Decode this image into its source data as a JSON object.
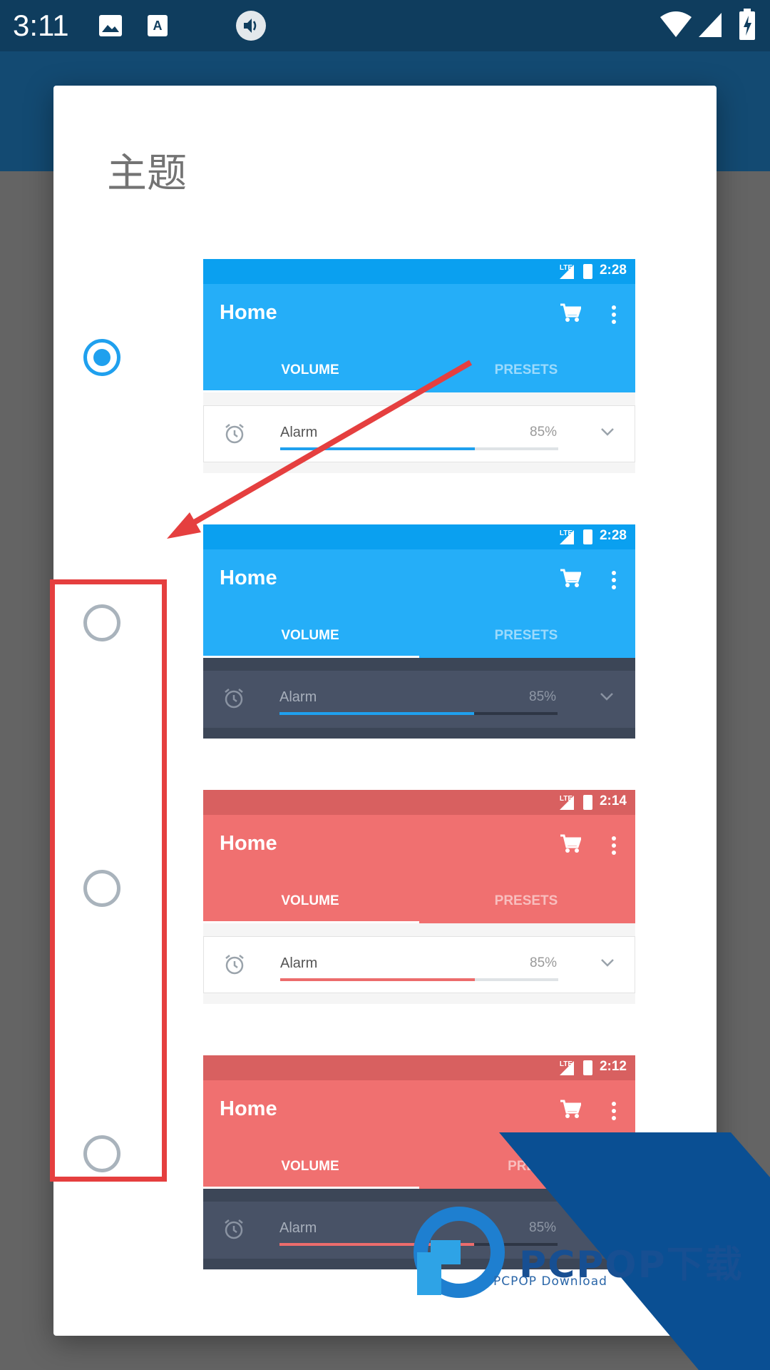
{
  "status_bar": {
    "time": "3:11"
  },
  "dialog": {
    "title": "主题"
  },
  "theme_options": [
    {
      "selected": true
    },
    {
      "selected": false
    },
    {
      "selected": false
    },
    {
      "selected": false
    }
  ],
  "previews": [
    {
      "clock": "2:28",
      "lte": "LTE",
      "title": "Home",
      "tab_volume": "VOLUME",
      "tab_presets": "PRESETS",
      "alarm_label": "Alarm",
      "alarm_percent": "85%",
      "alarm_level": 0.7
    },
    {
      "clock": "2:28",
      "lte": "LTE",
      "title": "Home",
      "tab_volume": "VOLUME",
      "tab_presets": "PRESETS",
      "alarm_label": "Alarm",
      "alarm_percent": "85%",
      "alarm_level": 0.7
    },
    {
      "clock": "2:14",
      "lte": "LTE",
      "title": "Home",
      "tab_volume": "VOLUME",
      "tab_presets": "PRESETS",
      "alarm_label": "Alarm",
      "alarm_percent": "85%",
      "alarm_level": 0.7
    },
    {
      "clock": "2:12",
      "lte": "LTE",
      "title": "Home",
      "tab_volume": "VOLUME",
      "tab_presets": "PRES",
      "alarm_label": "Alarm",
      "alarm_percent": "85%",
      "alarm_level": 0.7
    }
  ],
  "colors": {
    "accent_blue": "#1fa0ee",
    "accent_red": "#f07070",
    "annotation": "#e53f3f"
  },
  "watermark": {
    "brand": "PCPOP下载",
    "subtitle": "PCPOP Download"
  },
  "icons": [
    "image-icon",
    "a-icon",
    "volume-icon",
    "wifi-icon",
    "signal-icon",
    "battery-icon",
    "cart-icon",
    "more-vert-icon",
    "alarm-icon",
    "chevron-down-icon"
  ]
}
